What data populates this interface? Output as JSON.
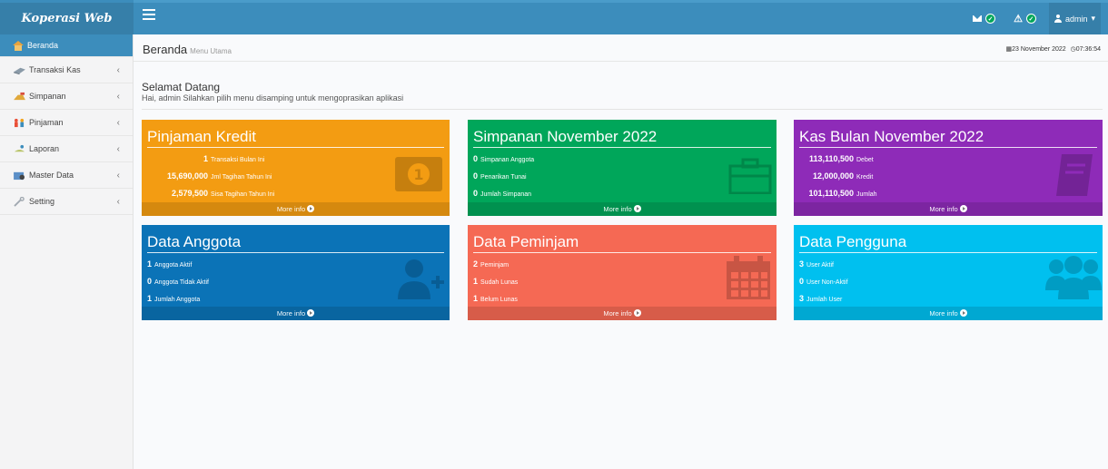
{
  "app": {
    "title": "Koperasi Web"
  },
  "header": {
    "mail_icon": "envelope-icon",
    "warn_icon": "warning-icon",
    "user_label": "admin",
    "user_caret": "▾",
    "check_glyph": "✓"
  },
  "sidebar": {
    "items": [
      {
        "label": "Beranda",
        "icon": "home-icon"
      },
      {
        "label": "Transaksi Kas",
        "icon": "cash-icon"
      },
      {
        "label": "Simpanan",
        "icon": "savings-icon"
      },
      {
        "label": "Pinjaman",
        "icon": "loan-icon"
      },
      {
        "label": "Laporan",
        "icon": "report-icon"
      },
      {
        "label": "Master Data",
        "icon": "database-icon"
      },
      {
        "label": "Setting",
        "icon": "wrench-icon"
      }
    ],
    "chevron": "‹"
  },
  "content": {
    "title": "Beranda",
    "subtitle": "Menu Utama",
    "date": "23 November 2022",
    "time": "07:36:54",
    "welcome_title": "Selamat Datang",
    "welcome_text": "Hai, admin Silahkan pilih menu disamping untuk mengoprasikan aplikasi"
  },
  "boxes": {
    "more_info": "More info",
    "pinjaman": {
      "title": "Pinjaman Kredit",
      "color": "#f39c12",
      "rows": [
        {
          "value": "1",
          "label": "Transaksi Bulan Ini"
        },
        {
          "value": "15,690,000",
          "label": "Jml Tagihan Tahun Ini"
        },
        {
          "value": "2,579,500",
          "label": "Sisa Tagihan Tahun Ini"
        }
      ]
    },
    "simpanan": {
      "title": "Simpanan November 2022",
      "color": "#00a65a",
      "rows": [
        {
          "value": "0",
          "label": "Simpanan Anggota"
        },
        {
          "value": "0",
          "label": "Penarikan Tunai"
        },
        {
          "value": "0",
          "label": "Jumlah Simpanan"
        }
      ]
    },
    "kas": {
      "title": "Kas Bulan November 2022",
      "color": "#8e2bb8",
      "rows": [
        {
          "value": "113,110,500",
          "label": "Debet"
        },
        {
          "value": "12,000,000",
          "label": "Kredit"
        },
        {
          "value": "101,110,500",
          "label": "Jumlah"
        }
      ]
    },
    "anggota": {
      "title": "Data Anggota",
      "color": "#0b73b7",
      "rows": [
        {
          "value": "1",
          "label": "Anggota Aktif"
        },
        {
          "value": "0",
          "label": "Anggota Tidak Aktif"
        },
        {
          "value": "1",
          "label": "Jumlah Anggota"
        }
      ]
    },
    "peminjam": {
      "title": "Data Peminjam",
      "color": "#f56954",
      "rows": [
        {
          "value": "2",
          "label": "Peminjam"
        },
        {
          "value": "1",
          "label": "Sudah Lunas"
        },
        {
          "value": "1",
          "label": "Belum Lunas"
        }
      ]
    },
    "pengguna": {
      "title": "Data Pengguna",
      "color": "#00c0ef",
      "rows": [
        {
          "value": "3",
          "label": "User Aktif"
        },
        {
          "value": "0",
          "label": "User Non-Aktif"
        },
        {
          "value": "3",
          "label": "Jumlah User"
        }
      ]
    }
  }
}
